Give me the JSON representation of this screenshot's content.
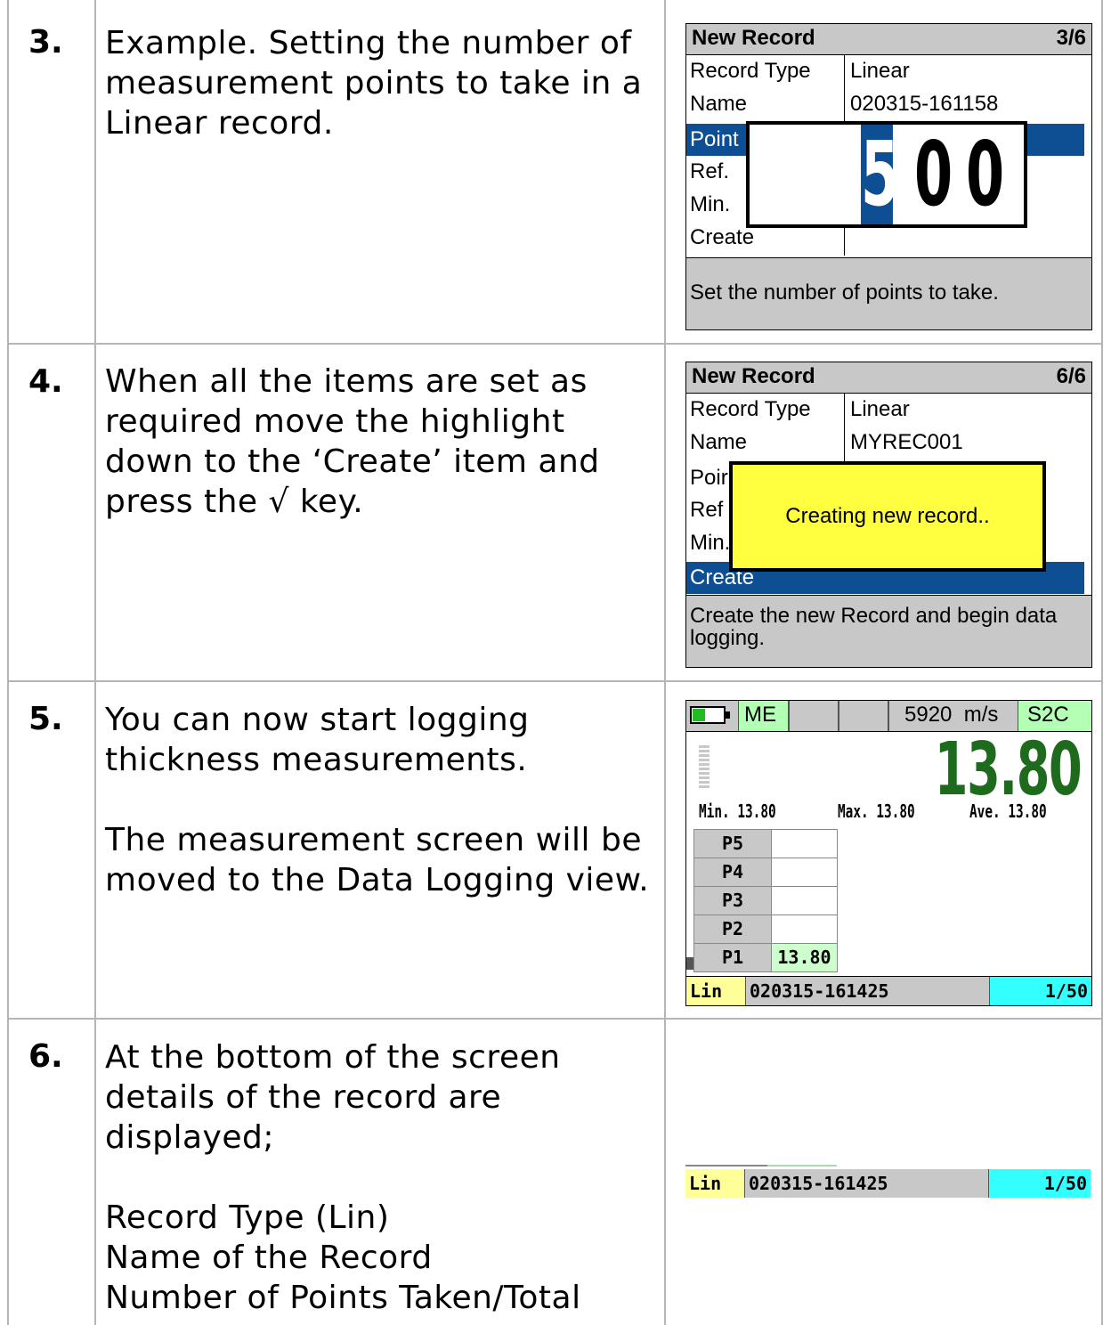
{
  "rows": [
    {
      "step": "3.",
      "text": "Example. Setting the number of measurement points to take in a Linear record."
    },
    {
      "step": "4.",
      "text": "When all the items are set as required move the highlight down to the ‘Create’ item and press the √ key."
    },
    {
      "step": "5.",
      "text": "You can now start logging thickness measurements.\n\nThe measurement screen will be moved to the Data Logging view."
    },
    {
      "step": "6.",
      "text": "At the bottom of the screen details of the record are displayed;\n\nRecord Type (Lin)\nName of the Record\nNumber of Points Taken/Total"
    }
  ],
  "screen3": {
    "title": "New Record",
    "page": "3/6",
    "items": [
      {
        "label": "Record Type",
        "value": "Linear"
      },
      {
        "label": "Name",
        "value": "020315-161158"
      },
      {
        "label": "Point",
        "value": ""
      },
      {
        "label": "Ref.",
        "value": ""
      },
      {
        "label": "Min. ",
        "value": ""
      },
      {
        "label": "Create",
        "value": ""
      }
    ],
    "digits": [
      "5",
      "0",
      "0"
    ],
    "help": "Set the number of points to take."
  },
  "screen4": {
    "title": "New Record",
    "page": "6/6",
    "items": [
      {
        "label": "Record Type",
        "value": "Linear"
      },
      {
        "label": "Name",
        "value": "MYREC001"
      },
      {
        "label": "Poir",
        "value": ""
      },
      {
        "label": "Ref",
        "value": ""
      },
      {
        "label": "Min.",
        "value": ""
      },
      {
        "label": "Create",
        "value": ""
      }
    ],
    "popup": "Creating new record..",
    "help": "Create the new Record and begin data logging."
  },
  "screen5": {
    "mode": "ME",
    "velocity": "5920  m/s",
    "probe": "S2C",
    "reading": "13.80",
    "min": "Min. 13.80",
    "max": "Max. 13.80",
    "ave": "Ave. 13.80",
    "points": [
      {
        "label": "P5",
        "value": ""
      },
      {
        "label": "P4",
        "value": ""
      },
      {
        "label": "P3",
        "value": ""
      },
      {
        "label": "P2",
        "value": ""
      },
      {
        "label": "P1",
        "value": "13.80"
      }
    ],
    "footer": {
      "type": "Lin",
      "name": "020315-161425",
      "count": "1/50"
    },
    "colors": {
      "reading": "#1e6b1e",
      "selection": "#0e4f94",
      "popup": "#ffff40",
      "count_bg": "#33ffff",
      "type_bg": "#ffff99",
      "p1_bg": "#ccffcc",
      "mode_bg": "#b3ffb3"
    }
  },
  "screen6": {
    "footer": {
      "type": "Lin",
      "name": "020315-161425",
      "count": "1/50"
    }
  }
}
